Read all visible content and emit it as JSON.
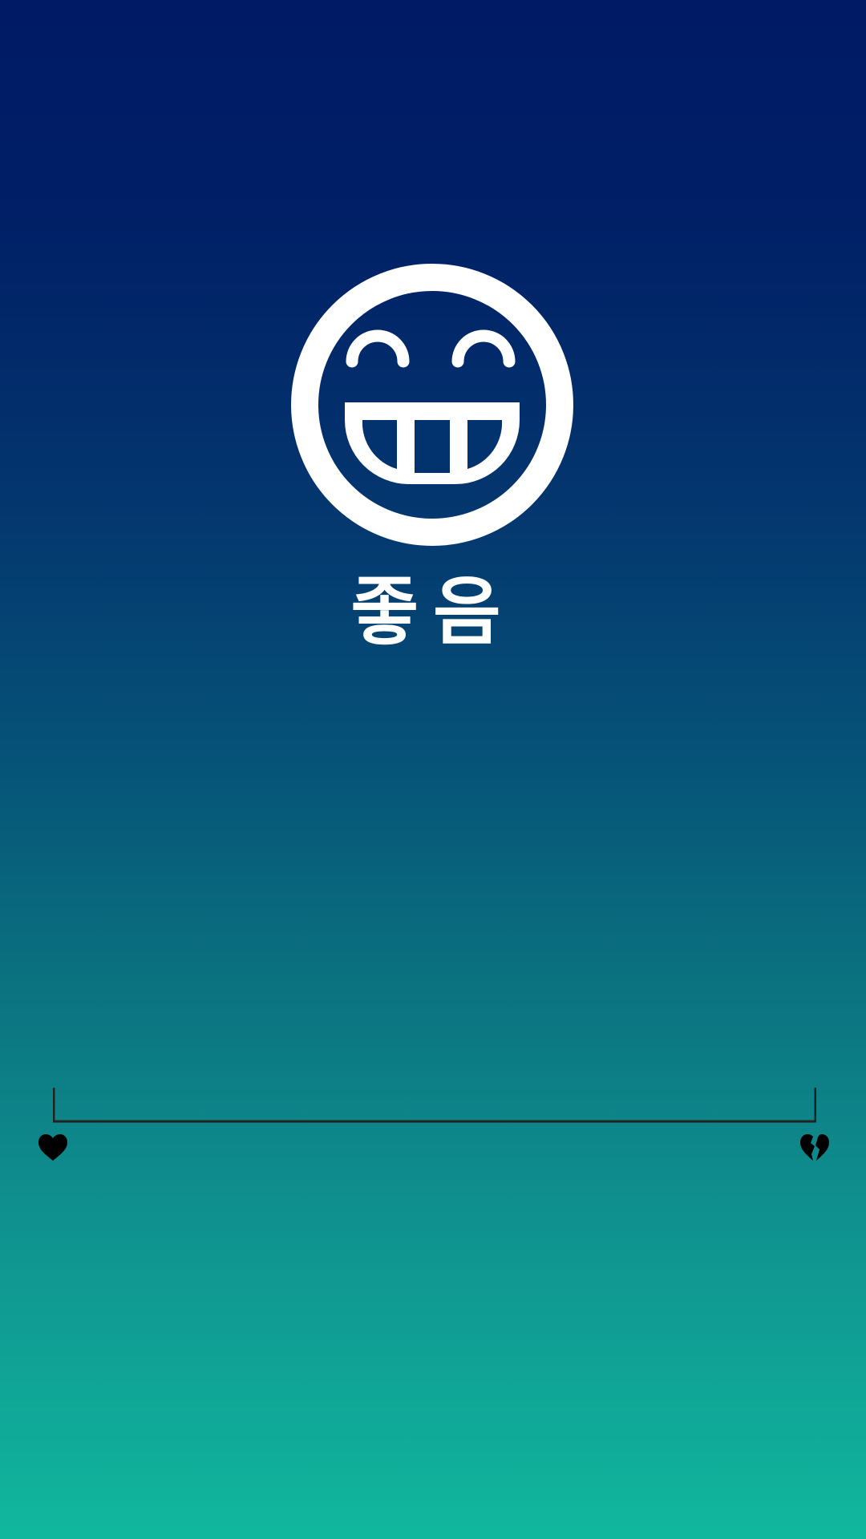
{
  "mood": {
    "label": "좋음",
    "icon": "grinning-face-icon"
  },
  "slider": {
    "min_icon": "heart-icon",
    "max_icon": "broken-heart-icon",
    "value": 1.0
  },
  "colors": {
    "gradient_top": "#001a66",
    "gradient_bottom": "#11b79d",
    "foreground": "#ffffff",
    "track": "#222222"
  }
}
